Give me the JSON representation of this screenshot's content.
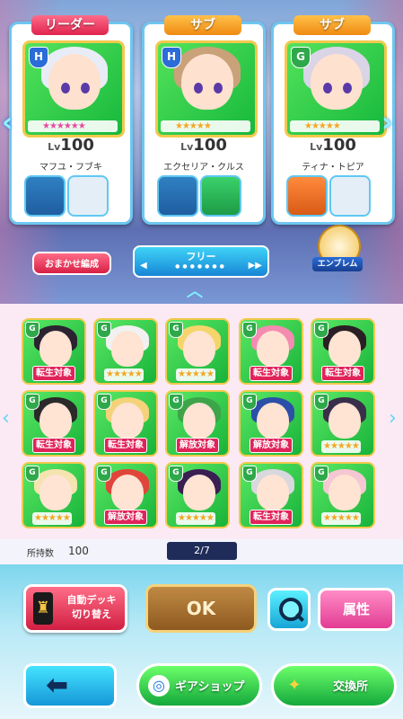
{
  "leaders": [
    {
      "role": "リーダー",
      "badge": "H",
      "lv_prefix": "Lv",
      "level": "100",
      "name": "マフユ・フブキ",
      "stars": "★★★★★★",
      "hair": "#e8ecf6",
      "gear2_label": ""
    },
    {
      "role": "サブ",
      "badge": "H",
      "lv_prefix": "Lv",
      "level": "100",
      "name": "エクセリア・クルス",
      "stars": "★★★★★",
      "hair": "#c9a27a",
      "gear2_label": ""
    },
    {
      "role": "サブ",
      "badge": "G",
      "lv_prefix": "Lv",
      "level": "100",
      "name": "ティナ・トピア",
      "stars": "★★★★★",
      "hair": "#d9d4e6",
      "gear2_label": ""
    }
  ],
  "controls": {
    "omakase": "おまかせ編成",
    "filter_label": "フリー",
    "emblem_label": "エンブレム"
  },
  "grid": [
    {
      "badge": "G",
      "tag": "転生対象",
      "tag_type": "red",
      "hair": "#2b2330"
    },
    {
      "badge": "G",
      "tag": "★★★★★",
      "tag_type": "stars",
      "hair": "#f1f1f1"
    },
    {
      "badge": "G",
      "tag": "★★★★★",
      "tag_type": "stars",
      "hair": "#f5d56b"
    },
    {
      "badge": "G",
      "tag": "転生対象",
      "tag_type": "red",
      "hair": "#f48bb0"
    },
    {
      "badge": "G",
      "tag": "転生対象",
      "tag_type": "red",
      "hair": "#2a1f24"
    },
    {
      "badge": "G",
      "tag": "転生対象",
      "tag_type": "red",
      "hair": "#2a2a2a"
    },
    {
      "badge": "G",
      "tag": "転生対象",
      "tag_type": "red",
      "hair": "#f4d27a"
    },
    {
      "badge": "G",
      "tag": "解放対象",
      "tag_type": "red",
      "hair": "#3ea44a"
    },
    {
      "badge": "G",
      "tag": "解放対象",
      "tag_type": "red",
      "hair": "#2c4fa8"
    },
    {
      "badge": "G",
      "tag": "★★★★★",
      "tag_type": "stars",
      "hair": "#3a2f4a"
    },
    {
      "badge": "G",
      "tag": "★★★★★",
      "tag_type": "stars",
      "hair": "#f3e4b0"
    },
    {
      "badge": "G",
      "tag": "解放対象",
      "tag_type": "red",
      "hair": "#e0453c"
    },
    {
      "badge": "G",
      "tag": "★★★★★",
      "tag_type": "stars",
      "hair": "#3a1f52"
    },
    {
      "badge": "G",
      "tag": "転生対象",
      "tag_type": "red",
      "hair": "#d8d8de"
    },
    {
      "badge": "G",
      "tag": "★★★★★",
      "tag_type": "stars",
      "hair": "#f4c7d2"
    }
  ],
  "status": {
    "owned_label": "所持数",
    "owned_value": "100",
    "page": "2/7"
  },
  "actions": {
    "auto_deck": "自動デッキ\n切り替え",
    "ok": "OK",
    "attribute": "属性",
    "gear_shop": "ギアショップ",
    "exchange": "交換所"
  }
}
